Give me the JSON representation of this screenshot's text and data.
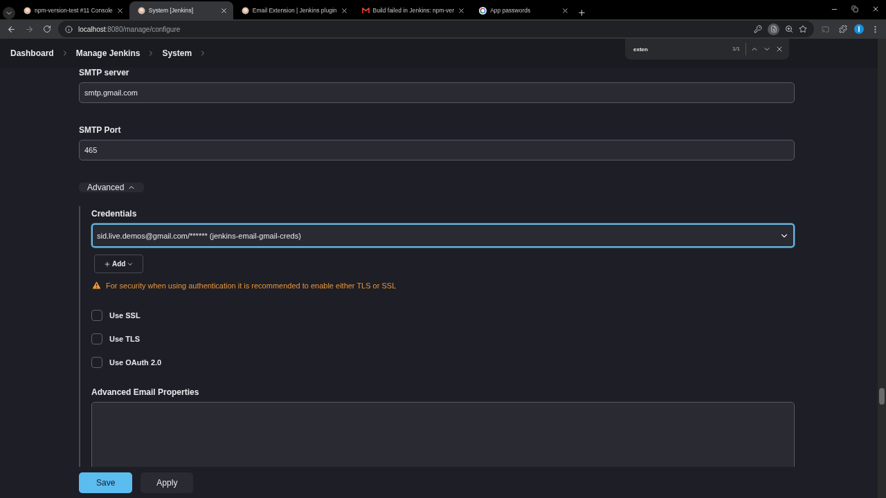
{
  "browser": {
    "tabs": [
      {
        "title": "npm-version-test #11 Console",
        "selected": false,
        "kind": "jenkins"
      },
      {
        "title": "System [Jenkins]",
        "selected": true,
        "kind": "jenkins"
      },
      {
        "title": "Email Extension | Jenkins plugin",
        "selected": false,
        "kind": "jenkins"
      },
      {
        "title": "Build failed in Jenkins: npm-ver",
        "selected": false,
        "kind": "mail"
      },
      {
        "title": "App passwords",
        "selected": false,
        "kind": "google"
      }
    ],
    "address": {
      "host": "localhost",
      "path": ":8080/manage/configure"
    },
    "find": {
      "query": "exten",
      "count": "1/1"
    }
  },
  "breadcrumbs": [
    "Dashboard",
    "Manage Jenkins",
    "System"
  ],
  "form": {
    "smtp_server": {
      "label": "SMTP server",
      "value": "smtp.gmail.com"
    },
    "smtp_port": {
      "label": "SMTP Port",
      "value": "465"
    },
    "advanced": {
      "label": "Advanced",
      "expanded": true
    },
    "credentials": {
      "label": "Credentials",
      "value": "sid.live.demos@gmail.com/****** (jenkins-email-gmail-creds)"
    },
    "add_button": "Add",
    "warning": "For security when using authentication it is recommended to enable either TLS or SSL",
    "checkboxes": [
      {
        "label": "Use SSL",
        "checked": false
      },
      {
        "label": "Use TLS",
        "checked": false
      },
      {
        "label": "Use OAuth 2.0",
        "checked": false
      }
    ],
    "advanced_email_properties": {
      "label": "Advanced Email Properties"
    }
  },
  "buttons": [
    {
      "label": "Save",
      "kind": "primary"
    },
    {
      "label": "Apply",
      "kind": "secondary"
    }
  ]
}
